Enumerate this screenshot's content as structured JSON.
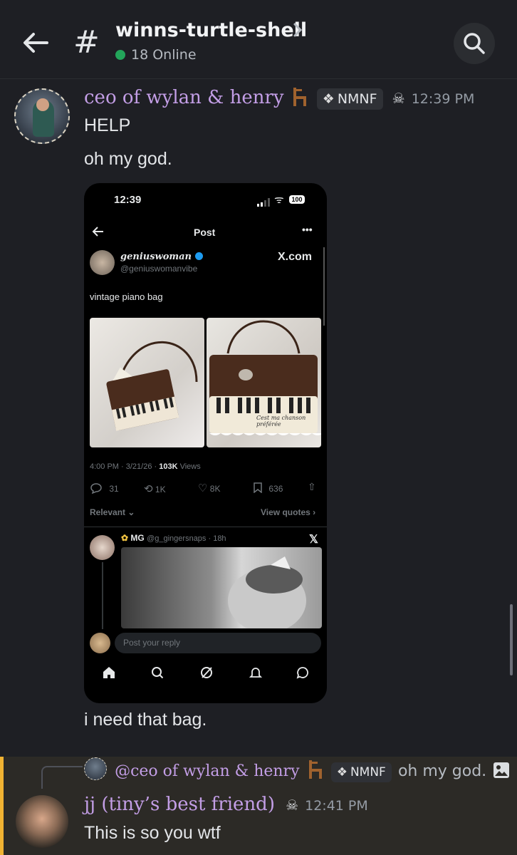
{
  "header": {
    "channel_name": "winns-turtle-shell",
    "online_text": "18 Online"
  },
  "message1": {
    "username": "ceo of wylan & henry",
    "tag": "NMNF",
    "timestamp": "12:39 PM",
    "lines": [
      "HELP",
      "oh my god."
    ],
    "after_text": "i need that bag."
  },
  "screenshot": {
    "status_time": "12:39",
    "battery": "100",
    "title": "Post",
    "author_name": "geniuswoman",
    "author_handle": "@geniuswomanvibe",
    "site_label": "X.com",
    "post_text": "vintage piano bag",
    "bag_text": "Cest ma chanson préférée",
    "meta_time": "4:00 PM · 3/21/26 · ",
    "meta_views": "103K",
    "meta_views_label": " Views",
    "stats": {
      "replies": "31",
      "reposts": "1K",
      "likes": "8K",
      "bookmarks": "636"
    },
    "sort_label": "Relevant",
    "quotes_label": "View quotes",
    "reply_name": "MG",
    "reply_handle": "@g_gingersnaps · 18h",
    "compose_placeholder": "Post your reply"
  },
  "reply": {
    "ref_username": "@ceo of wylan & henry",
    "ref_tag": "NMNF",
    "ref_text": "oh my god.",
    "username": "jj (tiny’s best friend)",
    "timestamp": "12:41 PM",
    "text": "This is so you wtf"
  },
  "colors": {
    "username": "#c39ee6",
    "online": "#23a55a",
    "reply_accent": "#f0b232"
  }
}
